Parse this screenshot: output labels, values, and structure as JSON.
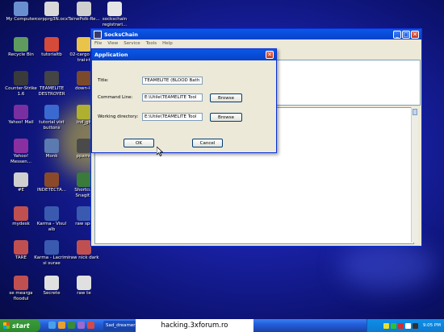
{
  "desktop": {
    "icons": [
      {
        "label": "My Computer",
        "icon": "computer-icon",
        "color": "#6a8fd0"
      },
      {
        "label": "corpprg3N.ocx",
        "icon": "file-icon",
        "color": "#d9d9d9"
      },
      {
        "label": "TainePolk-Re...",
        "icon": "file-icon",
        "color": "#cfcfcf"
      },
      {
        "label": "sockschain registrari...",
        "icon": "document-icon",
        "color": "#e6e6e6"
      },
      {
        "label": "Recycle Bin",
        "icon": "recycle-bin-icon",
        "color": "#5f9b5f"
      },
      {
        "label": "tutorialtb",
        "icon": "shortcut-icon",
        "color": "#d64a3a"
      },
      {
        "label": "02-cargo pot trai+t",
        "icon": "folder-icon",
        "color": "#e9c34a"
      },
      {
        "label": "Counter-Strike 1.6",
        "icon": "counter-strike-icon",
        "color": "#3a3a3a"
      },
      {
        "label": "TEAMELITE DESTROYER",
        "icon": "app-icon",
        "color": "#444444"
      },
      {
        "label": "down-lo",
        "icon": "app-icon",
        "color": "#7a4a2a"
      },
      {
        "label": "Yahoo! Mail",
        "icon": "yahoo-mail-icon",
        "color": "#7a2fa0"
      },
      {
        "label": "tutorial vist buttons",
        "icon": "folder-icon",
        "color": "#3a6ad0"
      },
      {
        "label": "ind_gif",
        "icon": "image-icon",
        "color": "#b0b030"
      },
      {
        "label": "Yahoo! Messen...",
        "icon": "yahoo-messenger-icon",
        "color": "#8a2fa0"
      },
      {
        "label": "Monk",
        "icon": "monk-icon",
        "color": "#5a7ab0"
      },
      {
        "label": "ppxmo",
        "icon": "app-icon",
        "color": "#4a4a4a"
      },
      {
        "label": "#E",
        "icon": "file-icon",
        "color": "#cfcfcf"
      },
      {
        "label": "INDETECTA...",
        "icon": "app-icon",
        "color": "#8a4a2a"
      },
      {
        "label": "Shortcut Snagit3",
        "icon": "snagit-icon",
        "color": "#3a7a3a"
      },
      {
        "label": "mydesk",
        "icon": "archive-icon",
        "color": "#c05050"
      },
      {
        "label": "Karma - Visul alb",
        "icon": "audio-icon",
        "color": "#3a5ab0"
      },
      {
        "label": "raw spe",
        "icon": "audio-icon",
        "color": "#3a5ab0"
      },
      {
        "label": "TARE",
        "icon": "archive-icon",
        "color": "#c05050"
      },
      {
        "label": "Karma - Lacrimi si surae",
        "icon": "audio-icon",
        "color": "#3a5ab0"
      },
      {
        "label": "raw nick dark",
        "icon": "archive-icon",
        "color": "#c05050"
      },
      {
        "label": "se mearga floodul",
        "icon": "archive-icon",
        "color": "#c05050"
      },
      {
        "label": "Secrete",
        "icon": "document-icon",
        "color": "#e0e0e0"
      },
      {
        "label": "raw te",
        "icon": "document-icon",
        "color": "#e0e0e0"
      }
    ]
  },
  "main_window": {
    "title": "SocksChain",
    "menu": [
      "File",
      "View",
      "Service",
      "Tools",
      "Help"
    ]
  },
  "dialog": {
    "title": "Application",
    "fields": [
      {
        "label": "Title:",
        "value": "TEAMELITE (BLOOD Bath)"
      },
      {
        "label": "Command Line:",
        "value": "E:\\Utile\\TEAMELITE Tool"
      },
      {
        "label": "Working directory:",
        "value": "E:\\Utile\\TEAMELITE Tool"
      }
    ],
    "browse_label": "Browse",
    "ok_label": "OK",
    "cancel_label": "Cancel"
  },
  "taskbar": {
    "start_label": "start",
    "task_label": "Sad_dreamer",
    "watermark": "hacking.3xforum.ro",
    "clock": "9:05 PM"
  }
}
